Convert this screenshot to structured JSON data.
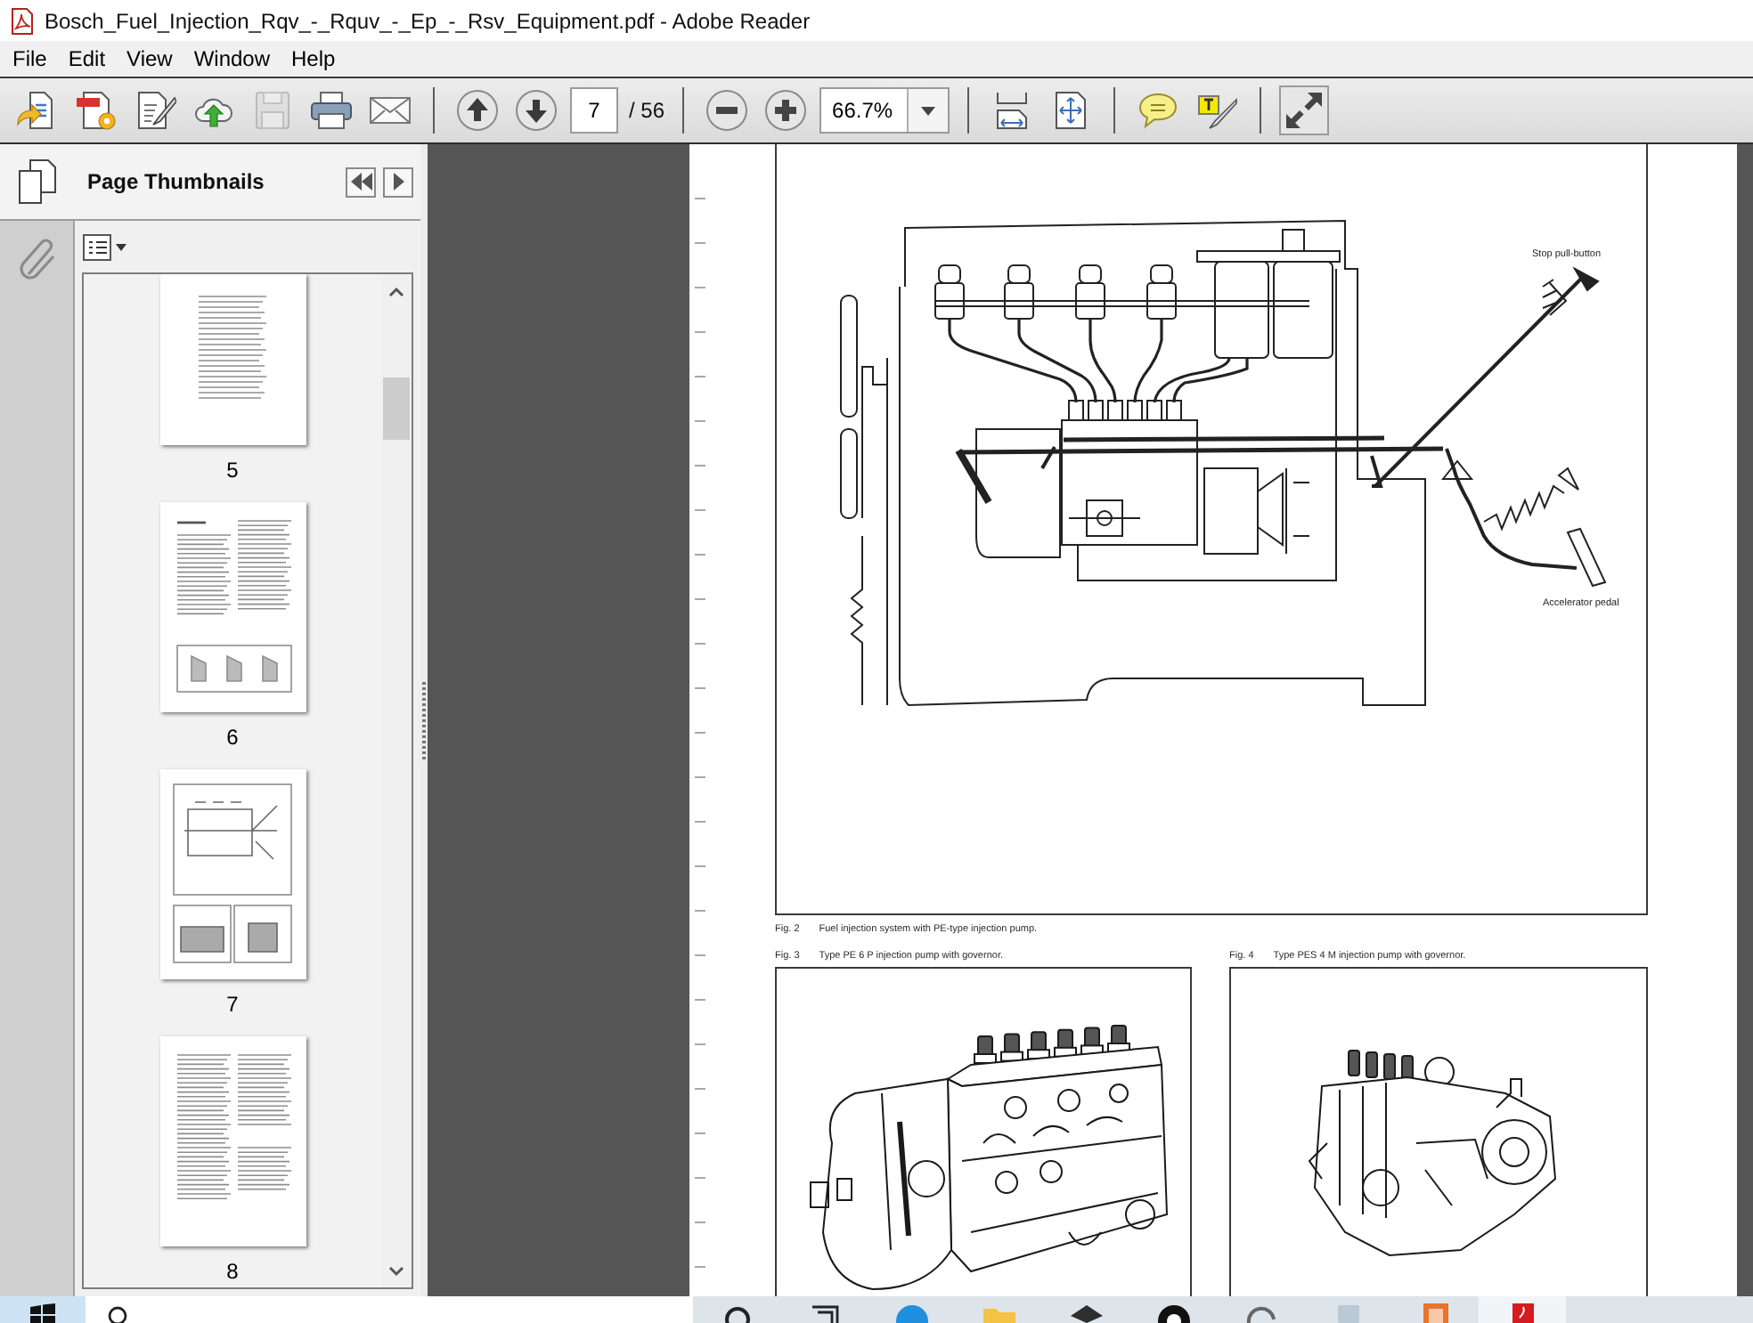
{
  "window": {
    "title": "Bosch_Fuel_Injection_Rqv_-_Rquv_-_Ep_-_Rsv_Equipment.pdf - Adobe Reader"
  },
  "menu": [
    "File",
    "Edit",
    "View",
    "Window",
    "Help"
  ],
  "toolbar": {
    "file_buttons": [
      {
        "kind": "create",
        "disabled": false
      },
      {
        "kind": "combine",
        "disabled": false
      },
      {
        "kind": "sign",
        "disabled": false
      },
      {
        "kind": "upload",
        "disabled": false
      },
      {
        "kind": "save",
        "disabled": true
      },
      {
        "kind": "print",
        "disabled": false
      },
      {
        "kind": "email",
        "disabled": false
      }
    ],
    "page_buttons": [
      {
        "kind": "previous"
      },
      {
        "kind": "next"
      }
    ],
    "page": "7",
    "total": "/ 56",
    "zoom_buttons": [
      {
        "kind": "zoomout"
      },
      {
        "kind": "zoomin"
      }
    ],
    "zoom": "66.7%",
    "view_buttons": [
      {
        "kind": "fitwidth"
      },
      {
        "kind": "fitpage"
      }
    ],
    "comment_buttons": [
      {
        "kind": "note"
      },
      {
        "kind": "highlight"
      }
    ],
    "mode_buttons": [
      {
        "kind": "fullscreen"
      }
    ]
  },
  "panel": {
    "title": "Page Thumbnails",
    "thumbnails": [
      {
        "label": "5",
        "kind": "column"
      },
      {
        "label": "6",
        "kind": "mixed"
      },
      {
        "label": "7",
        "kind": "figures"
      },
      {
        "label": "8",
        "kind": "text"
      }
    ]
  },
  "document": {
    "figures": [
      {
        "number": "Fig. 2",
        "caption": "Fuel injection system with PE-type injection pump.",
        "kind": "system",
        "labels": [
          "Stop pull-button",
          "Accelerator pedal"
        ]
      },
      {
        "number": "Fig. 3",
        "caption": "Type PE 6 P injection pump with governor.",
        "kind": "inline"
      },
      {
        "number": "Fig. 4",
        "caption": "Type PES 4 M injection pump with governor.",
        "kind": "distributor"
      }
    ]
  },
  "taskbar": {
    "apps": [
      {
        "kind": "ring",
        "selected": false
      },
      {
        "kind": "taskview",
        "selected": false
      },
      {
        "kind": "browser",
        "selected": false
      },
      {
        "kind": "folder",
        "selected": false
      },
      {
        "kind": "cap",
        "selected": false
      },
      {
        "kind": "disc",
        "selected": false
      },
      {
        "kind": "dial",
        "selected": false
      },
      {
        "kind": "tablet",
        "selected": false
      },
      {
        "kind": "photos",
        "selected": false
      },
      {
        "kind": "pdf",
        "selected": true
      }
    ]
  }
}
